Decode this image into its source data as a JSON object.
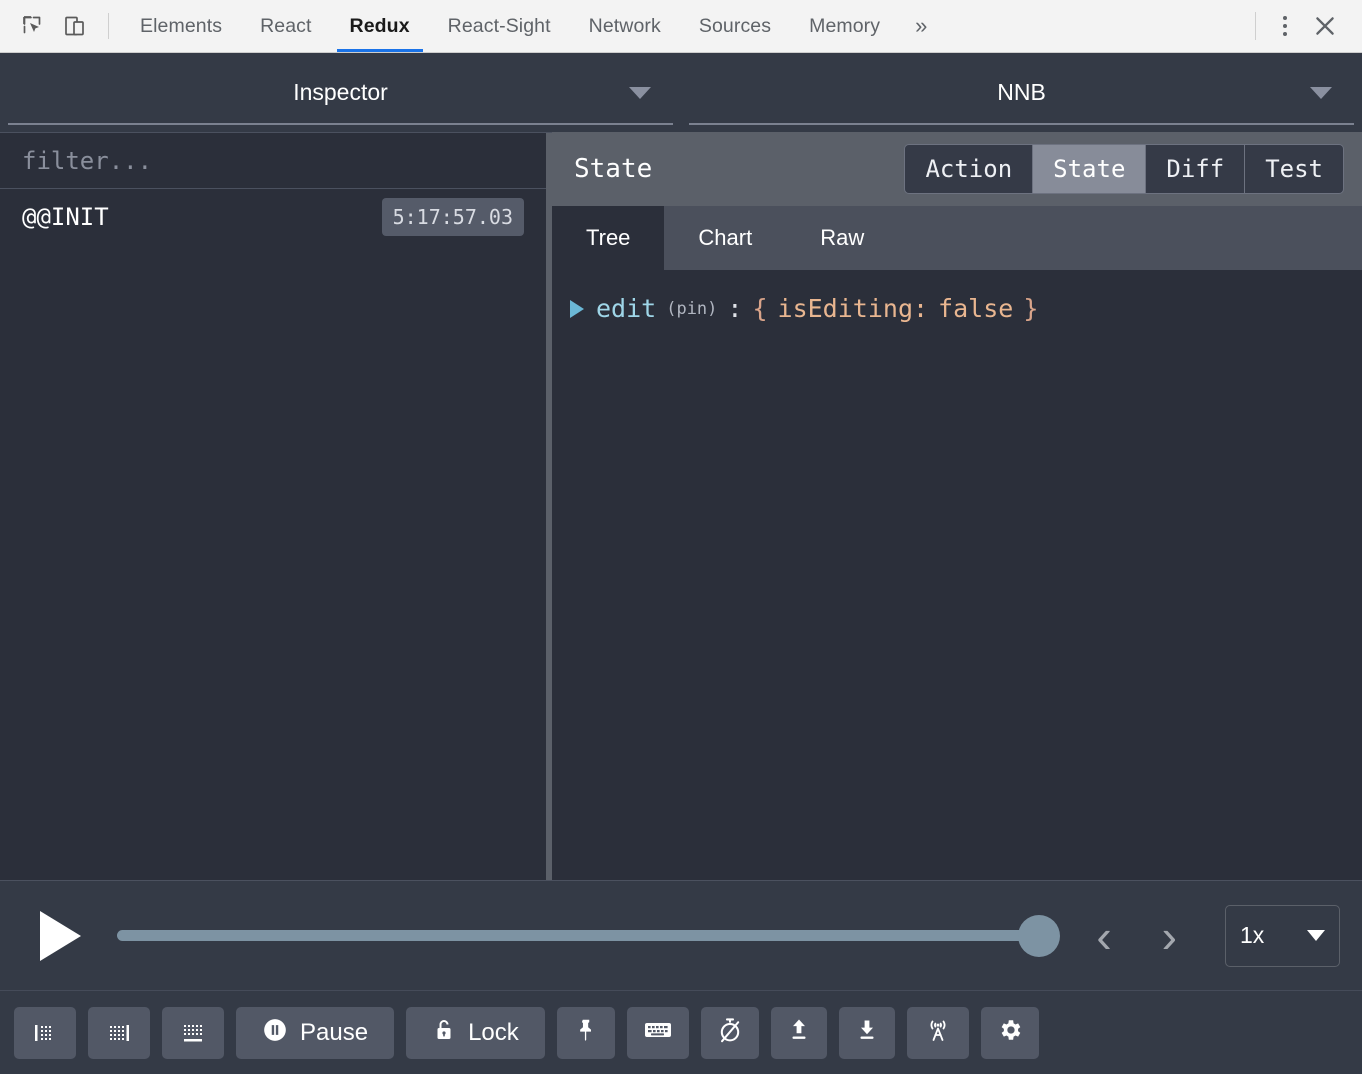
{
  "devtools": {
    "icons": {
      "inspect": "inspect-element-icon",
      "device": "device-toolbar-icon",
      "more": "»",
      "close": "✕"
    },
    "tabs": [
      {
        "label": "Elements",
        "active": false
      },
      {
        "label": "React",
        "active": false
      },
      {
        "label": "Redux",
        "active": true
      },
      {
        "label": "React-Sight",
        "active": false
      },
      {
        "label": "Network",
        "active": false
      },
      {
        "label": "Sources",
        "active": false
      },
      {
        "label": "Memory",
        "active": false
      }
    ]
  },
  "selectors": {
    "left": {
      "label": "Inspector"
    },
    "right": {
      "label": "NNB"
    }
  },
  "actions": {
    "filter_placeholder": "filter...",
    "filter_value": "",
    "items": [
      {
        "name": "@@INIT",
        "time": "5:17:57.03"
      }
    ]
  },
  "inspector": {
    "title": "State",
    "segments": [
      {
        "label": "Action",
        "active": false
      },
      {
        "label": "State",
        "active": true
      },
      {
        "label": "Diff",
        "active": false
      },
      {
        "label": "Test",
        "active": false
      }
    ],
    "subtabs": [
      {
        "label": "Tree",
        "active": true
      },
      {
        "label": "Chart",
        "active": false
      },
      {
        "label": "Raw",
        "active": false
      }
    ],
    "tree": {
      "key": "edit",
      "pin": "(pin)",
      "colon": ":",
      "open_brace": "{",
      "prop": "isEditing:",
      "value": "false",
      "close_brace": "}"
    }
  },
  "player": {
    "play_icon": "play-icon",
    "slider_value": 100,
    "prev_icon": "‹",
    "next_icon": "›",
    "speed": "1x"
  },
  "toolbar": {
    "buttons": [
      {
        "name": "dock-left-button",
        "icon": "dock-left-icon",
        "label": ""
      },
      {
        "name": "dock-right-button",
        "icon": "dock-right-icon",
        "label": ""
      },
      {
        "name": "dock-bottom-button",
        "icon": "dock-bottom-icon",
        "label": ""
      },
      {
        "name": "pause-button",
        "icon": "pause-icon",
        "label": "Pause"
      },
      {
        "name": "lock-button",
        "icon": "lock-icon",
        "label": "Lock"
      },
      {
        "name": "pin-button",
        "icon": "pin-icon",
        "label": ""
      },
      {
        "name": "keyboard-button",
        "icon": "keyboard-icon",
        "label": ""
      },
      {
        "name": "timer-off-button",
        "icon": "timer-off-icon",
        "label": ""
      },
      {
        "name": "import-button",
        "icon": "upload-icon",
        "label": ""
      },
      {
        "name": "export-button",
        "icon": "download-icon",
        "label": ""
      },
      {
        "name": "remote-button",
        "icon": "broadcast-icon",
        "label": ""
      },
      {
        "name": "settings-button",
        "icon": "gear-icon",
        "label": ""
      }
    ]
  },
  "colors": {
    "accent": "#1a73e8",
    "panel_bg": "#2b2f3a",
    "header_bg": "#5b6069",
    "slider": "#7d93a3"
  }
}
